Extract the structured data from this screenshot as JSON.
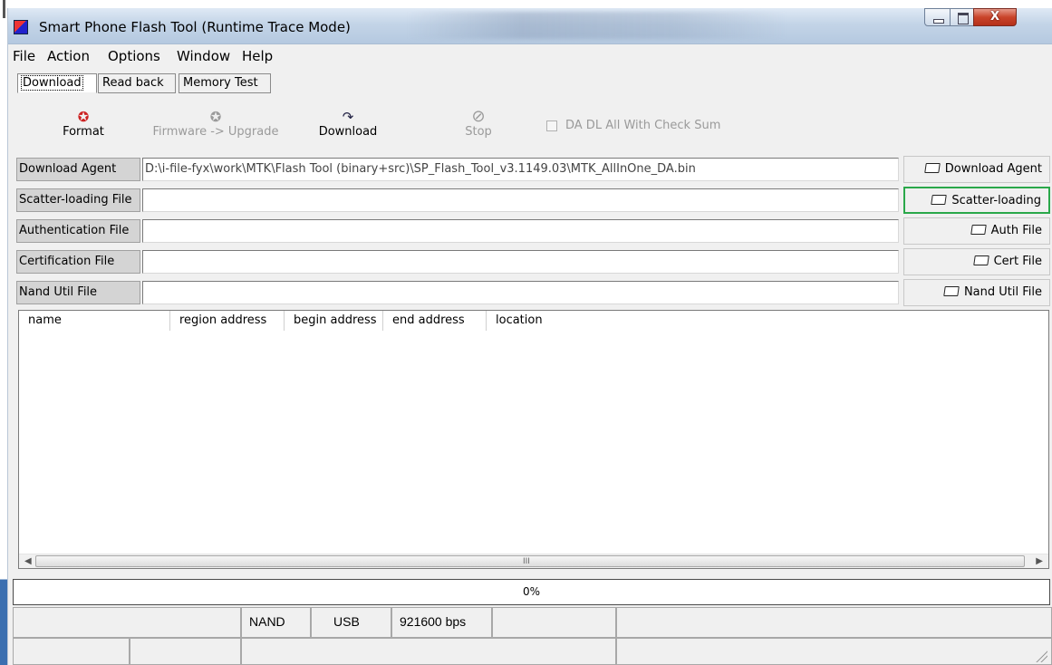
{
  "window": {
    "title": "Smart Phone Flash Tool (Runtime Trace Mode)",
    "close_glyph": "X"
  },
  "menu": [
    "File",
    "Action",
    "Options",
    "Window",
    "Help"
  ],
  "tabs": [
    "Download",
    "Read back",
    "Memory Test"
  ],
  "toolbar": {
    "format": "Format",
    "firmware_upgrade": "Firmware -> Upgrade",
    "download": "Download",
    "stop": "Stop",
    "checksum_label": "DA DL All With Check Sum"
  },
  "files": {
    "download_agent": {
      "label": "Download Agent",
      "value": "D:\\i-file-fyx\\work\\MTK\\Flash Tool (binary+src)\\SP_Flash_Tool_v3.1149.03\\MTK_AllInOne_DA.bin",
      "button": "Download Agent"
    },
    "scatter": {
      "label": "Scatter-loading File",
      "value": "",
      "button": "Scatter-loading"
    },
    "auth": {
      "label": "Authentication File",
      "value": "",
      "button": "Auth File"
    },
    "cert": {
      "label": "Certification File",
      "value": "",
      "button": "Cert File"
    },
    "nand": {
      "label": "Nand Util File",
      "value": "",
      "button": "Nand Util File"
    }
  },
  "list": {
    "columns": [
      "name",
      "region address",
      "begin address",
      "end address",
      "location"
    ],
    "scroll_grip": "III"
  },
  "progress": "0%",
  "status": {
    "storage": "NAND",
    "port": "USB",
    "baud": "921600 bps"
  },
  "colors": {
    "highlight_border": "#2aa84a",
    "titlebar": "#c3d4e7",
    "close_button": "#c9442a"
  }
}
